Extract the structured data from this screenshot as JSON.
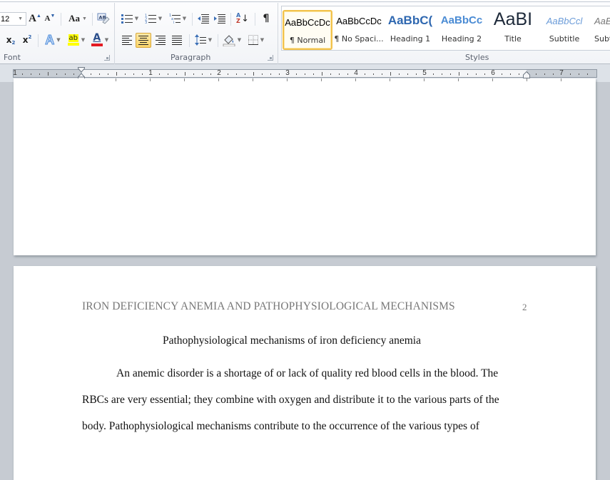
{
  "ribbon": {
    "font_group": {
      "label": "Font",
      "font_size": "12",
      "grow_font_label": "A",
      "shrink_font_label": "A",
      "change_case_label": "Aa",
      "clear_formatting_label": "AB",
      "subscript_label": "x",
      "subscript_sub": "2",
      "superscript_label": "x",
      "superscript_sup": "2",
      "text_effects_label": "A",
      "highlight_label": "ab",
      "font_color_label": "A",
      "highlight_color": "#ffff00",
      "font_color": "#e31b23"
    },
    "paragraph_group": {
      "label": "Paragraph",
      "sort_label_a": "A",
      "sort_label_z": "Z",
      "show_marks_label": "¶",
      "active_alignment": "center"
    },
    "styles_group": {
      "label": "Styles",
      "items": [
        {
          "preview": "AaBbCcDc",
          "name": "¶ Normal",
          "selected": true
        },
        {
          "preview": "AaBbCcDc",
          "name": "¶ No Spaci...",
          "selected": false
        },
        {
          "preview": "AaBbC(",
          "name": "Heading 1",
          "selected": false
        },
        {
          "preview": "AaBbCc",
          "name": "Heading 2",
          "selected": false
        },
        {
          "preview": "AaBI",
          "name": "Title",
          "selected": false
        },
        {
          "preview": "AaBbCcl",
          "name": "Subtitle",
          "selected": false
        },
        {
          "preview": "AaB",
          "name": "Subt",
          "selected": false
        }
      ]
    }
  },
  "ruler": {
    "labels": [
      "1",
      "1",
      "2",
      "3",
      "4",
      "5",
      "6",
      "7"
    ]
  },
  "document": {
    "page2": {
      "running_head": "IRON DEFICIENCY ANEMIA AND PATHOPHYSIOLOGICAL MECHANISMS",
      "page_number": "2",
      "title": "Pathophysiological mechanisms of iron deficiency anemia",
      "lines": [
        "An anemic disorder is a shortage of or lack of quality red blood cells in the blood. The",
        "RBCs are very essential; they combine with oxygen and distribute it to the various parts of the",
        "body. Pathophysiological mechanisms contribute to the occurrence of the various types of"
      ]
    }
  }
}
